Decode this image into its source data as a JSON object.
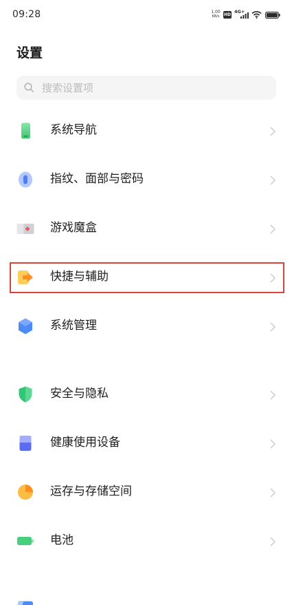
{
  "status_bar": {
    "time": "09:28",
    "net_speed": {
      "value": "1.00",
      "unit": "KB/s"
    },
    "hd_label": "HD",
    "network_type": "4G+",
    "icons": [
      "signal-bars-icon",
      "wifi-icon",
      "battery-status-icon"
    ]
  },
  "header": {
    "title": "设置"
  },
  "search": {
    "placeholder": "搜索设置项",
    "icon": "search-icon"
  },
  "settings_groups": [
    {
      "items": [
        {
          "label": "系统导航",
          "icon": "system-navigation-icon"
        },
        {
          "label": "指纹、面部与密码",
          "icon": "fingerprint-icon"
        },
        {
          "label": "游戏魔盒",
          "icon": "game-box-icon"
        },
        {
          "label": "快捷与辅助",
          "icon": "shortcut-assist-icon",
          "highlighted": true
        },
        {
          "label": "系统管理",
          "icon": "system-management-icon"
        }
      ]
    },
    {
      "items": [
        {
          "label": "安全与隐私",
          "icon": "shield-icon"
        },
        {
          "label": "健康使用设备",
          "icon": "healthy-usage-icon"
        },
        {
          "label": "运存与存储空间",
          "icon": "storage-pie-icon"
        },
        {
          "label": "电池",
          "icon": "battery-icon"
        }
      ]
    },
    {
      "items": [
        {
          "icon": "partial-settings-icon"
        }
      ]
    }
  ],
  "colors": {
    "background": "#ffffff",
    "text": "#1f1f1f",
    "placeholder": "#bcbcbc",
    "search-bg": "#f5f5f5",
    "chevron": "#c9c9c9",
    "highlight": "#d9433a",
    "status": "#2b2b2b"
  }
}
